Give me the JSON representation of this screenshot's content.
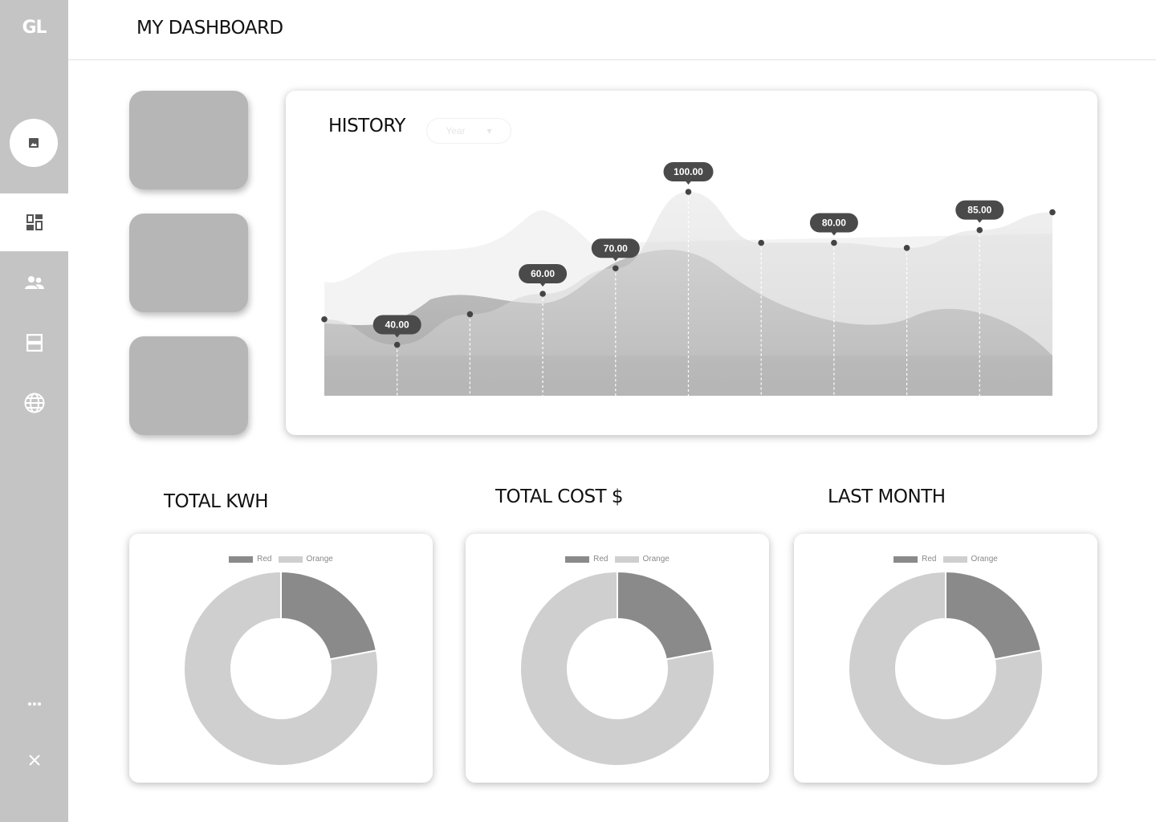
{
  "app": {
    "logo": "GL",
    "title": "MY DASHBOARD"
  },
  "sidebar": {
    "items": [
      {
        "name": "dashboard",
        "icon": "dashboard-icon",
        "active": true
      },
      {
        "name": "users",
        "icon": "people-icon",
        "active": false
      },
      {
        "name": "storage",
        "icon": "storage-icon",
        "active": false
      },
      {
        "name": "globe",
        "icon": "globe-icon",
        "active": false
      }
    ],
    "more_icon": "more-icon",
    "close_icon": "close-icon"
  },
  "history": {
    "title": "HISTORY",
    "select_value": "Year",
    "chart_data": {
      "type": "area",
      "title": "HISTORY",
      "x": [
        0,
        1,
        2,
        3,
        4,
        5,
        6,
        7,
        8,
        9,
        10
      ],
      "series": [
        {
          "values": [
            50,
            40,
            52,
            60,
            70,
            100,
            80,
            80,
            78,
            85,
            92
          ]
        }
      ],
      "labels": [
        {
          "index": 1,
          "text": "40.00"
        },
        {
          "index": 3,
          "text": "60.00"
        },
        {
          "index": 4,
          "text": "70.00"
        },
        {
          "index": 5,
          "text": "100.00"
        },
        {
          "index": 7,
          "text": "80.00"
        },
        {
          "index": 9,
          "text": "85.00"
        }
      ]
    }
  },
  "donuts": [
    {
      "title": "TOTAL KWH",
      "chart_data": {
        "type": "pie",
        "categories": [
          "Red",
          "Orange"
        ],
        "values": [
          22,
          78
        ],
        "colors": [
          "#8a8a8a",
          "#cfcfcf"
        ]
      }
    },
    {
      "title": "TOTAL COST $",
      "chart_data": {
        "type": "pie",
        "categories": [
          "Red",
          "Orange"
        ],
        "values": [
          22,
          78
        ],
        "colors": [
          "#8a8a8a",
          "#cfcfcf"
        ]
      }
    },
    {
      "title": "LAST MONTH",
      "chart_data": {
        "type": "pie",
        "categories": [
          "Red",
          "Orange"
        ],
        "values": [
          22,
          78
        ],
        "colors": [
          "#8a8a8a",
          "#cfcfcf"
        ]
      }
    }
  ]
}
